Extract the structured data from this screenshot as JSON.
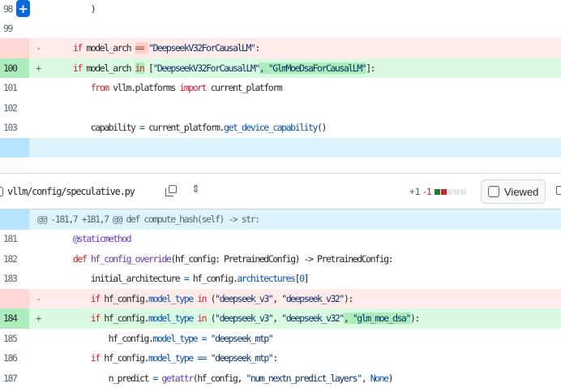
{
  "top_diff": {
    "rows": [
      {
        "type": "ctx",
        "ln": "98",
        "sign": "",
        "tokens": [
          [
            "        )",
            "p"
          ]
        ]
      },
      {
        "type": "ctx",
        "ln": "99",
        "sign": "",
        "tokens": []
      },
      {
        "type": "del",
        "ln": "",
        "sign": "-",
        "tokens": [
          [
            "    ",
            "p"
          ],
          [
            "if",
            "k"
          ],
          [
            " model_arch ",
            "p"
          ],
          [
            "==",
            "k hl-del"
          ],
          [
            " ",
            "p hl-del"
          ],
          [
            "\"DeepseekV32ForCausalLM\"",
            "s"
          ],
          [
            ":",
            "p"
          ]
        ]
      },
      {
        "type": "add",
        "ln": "100",
        "sign": "+",
        "tokens": [
          [
            "    ",
            "p"
          ],
          [
            "if",
            "k"
          ],
          [
            " model_arch ",
            "p"
          ],
          [
            "in",
            "k hl-add"
          ],
          [
            " [",
            "p"
          ],
          [
            "\"DeepseekV32ForCausalLM\"",
            "s"
          ],
          [
            ", ",
            "p hl-add"
          ],
          [
            "\"GlmMoeDsaForCausalLM\"",
            "s hl-add"
          ],
          [
            "]:",
            "p"
          ]
        ]
      },
      {
        "type": "ctx",
        "ln": "101",
        "sign": "",
        "tokens": [
          [
            "        ",
            "p"
          ],
          [
            "from",
            "k"
          ],
          [
            " vllm.platforms ",
            "p"
          ],
          [
            "import",
            "k"
          ],
          [
            " current_platform",
            "p"
          ]
        ]
      },
      {
        "type": "ctx",
        "ln": "102",
        "sign": "",
        "tokens": []
      },
      {
        "type": "ctx",
        "ln": "103",
        "sign": "",
        "tokens": [
          [
            "        capability ",
            "p"
          ],
          [
            "=",
            "c"
          ],
          [
            " current_platform.",
            "p"
          ],
          [
            "get_device_capability",
            "c"
          ],
          [
            "()",
            "p"
          ]
        ]
      },
      {
        "type": "hunk",
        "ln": "",
        "sign": "",
        "tokens": []
      }
    ]
  },
  "file": {
    "path": "vllm/config/speculative.py",
    "additions": "+1",
    "deletions": "-1",
    "viewed_label": "Viewed",
    "colors": {
      "add": "#1a7f37",
      "del": "#d1242f"
    }
  },
  "bottom_diff": {
    "hunk_header": "@@ -181,7 +181,7 @@ def compute_hash(self) -> str:",
    "rows": [
      {
        "type": "ctx",
        "ln": "181",
        "sign": "",
        "tokens": [
          [
            "    ",
            "p"
          ],
          [
            "@staticmethod",
            "f"
          ]
        ]
      },
      {
        "type": "ctx",
        "ln": "182",
        "sign": "",
        "tokens": [
          [
            "    ",
            "p"
          ],
          [
            "def",
            "k"
          ],
          [
            " ",
            "p"
          ],
          [
            "hf_config_override",
            "f"
          ],
          [
            "(hf_config: PretrainedConfig) -> PretrainedConfig:",
            "p"
          ]
        ]
      },
      {
        "type": "ctx",
        "ln": "183",
        "sign": "",
        "tokens": [
          [
            "        initial_architecture ",
            "p"
          ],
          [
            "=",
            "c"
          ],
          [
            " hf_config.",
            "p"
          ],
          [
            "architectures",
            "c"
          ],
          [
            "[",
            "p"
          ],
          [
            "0",
            "c"
          ],
          [
            "]",
            "p"
          ]
        ]
      },
      {
        "type": "del",
        "ln": "",
        "sign": "-",
        "tokens": [
          [
            "        ",
            "p"
          ],
          [
            "if",
            "k"
          ],
          [
            " hf_config.",
            "p"
          ],
          [
            "model_type",
            "c"
          ],
          [
            " ",
            "p"
          ],
          [
            "in",
            "k"
          ],
          [
            " (",
            "p"
          ],
          [
            "\"deepseek_v3\"",
            "s"
          ],
          [
            ", ",
            "p"
          ],
          [
            "\"deepseek_v32\"",
            "s"
          ],
          [
            "):",
            "p"
          ]
        ]
      },
      {
        "type": "add",
        "ln": "184",
        "sign": "+",
        "tokens": [
          [
            "        ",
            "p"
          ],
          [
            "if",
            "k"
          ],
          [
            " hf_config.",
            "p"
          ],
          [
            "model_type",
            "c"
          ],
          [
            " ",
            "p"
          ],
          [
            "in",
            "k"
          ],
          [
            " (",
            "p"
          ],
          [
            "\"deepseek_v3\"",
            "s"
          ],
          [
            ", ",
            "p"
          ],
          [
            "\"deepseek_v32\"",
            "s"
          ],
          [
            ", ",
            "p hl-add"
          ],
          [
            "\"glm_moe_dsa\"",
            "s hl-add"
          ],
          [
            "):",
            "p"
          ]
        ]
      },
      {
        "type": "ctx",
        "ln": "185",
        "sign": "",
        "tokens": [
          [
            "            hf_config.",
            "p"
          ],
          [
            "model_type",
            "c"
          ],
          [
            " ",
            "p"
          ],
          [
            "=",
            "c"
          ],
          [
            " ",
            "p"
          ],
          [
            "\"deepseek_mtp\"",
            "s"
          ]
        ]
      },
      {
        "type": "ctx",
        "ln": "186",
        "sign": "",
        "tokens": [
          [
            "        ",
            "p"
          ],
          [
            "if",
            "k"
          ],
          [
            " hf_config.",
            "p"
          ],
          [
            "model_type",
            "c"
          ],
          [
            " ",
            "p"
          ],
          [
            "==",
            "c"
          ],
          [
            " ",
            "p"
          ],
          [
            "\"deepseek_mtp\"",
            "s"
          ],
          [
            ":",
            "p"
          ]
        ]
      },
      {
        "type": "ctx",
        "ln": "187",
        "sign": "",
        "tokens": [
          [
            "            n_predict ",
            "p"
          ],
          [
            "=",
            "c"
          ],
          [
            " ",
            "p"
          ],
          [
            "getattr",
            "f"
          ],
          [
            "(hf_config, ",
            "p"
          ],
          [
            "\"num_nextn_predict_layers\"",
            "s"
          ],
          [
            ", ",
            "p"
          ],
          [
            "None",
            "c"
          ],
          [
            ")",
            "p"
          ]
        ]
      }
    ]
  }
}
